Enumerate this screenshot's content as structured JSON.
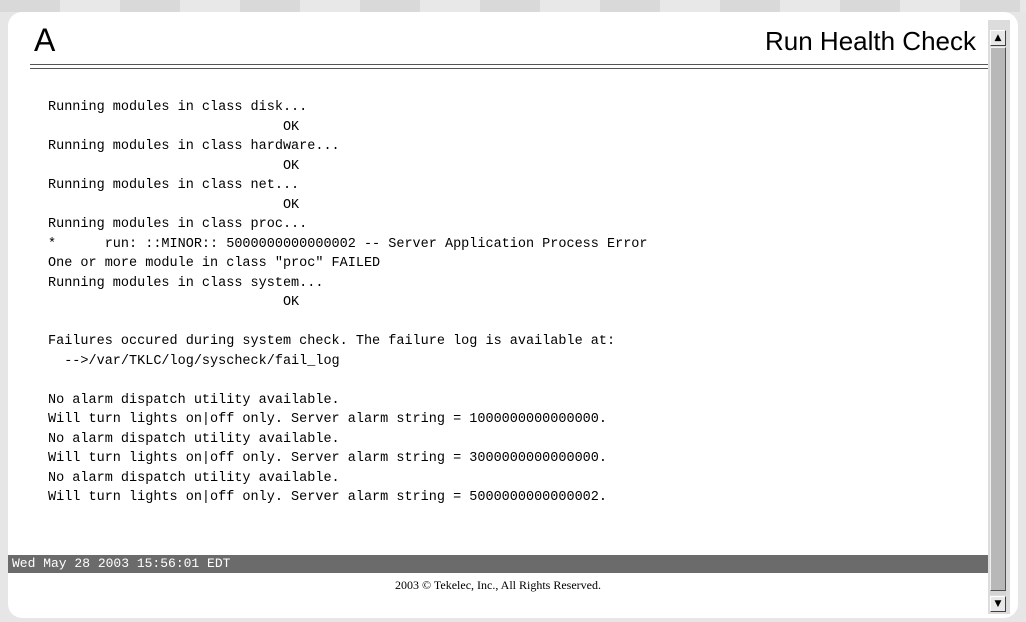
{
  "header": {
    "logo": "A",
    "title": "Run Health Check"
  },
  "output": {
    "lines": [
      "Running modules in class disk...",
      "                             OK",
      "Running modules in class hardware...",
      "                             OK",
      "Running modules in class net...",
      "                             OK",
      "Running modules in class proc...",
      "*      run: ::MINOR:: 5000000000000002 -- Server Application Process Error",
      "One or more module in class \"proc\" FAILED",
      "Running modules in class system...",
      "                             OK",
      "",
      "Failures occured during system check. The failure log is available at:",
      "  -->/var/TKLC/log/syscheck/fail_log",
      "",
      "No alarm dispatch utility available.",
      "Will turn lights on|off only. Server alarm string = 1000000000000000.",
      "No alarm dispatch utility available.",
      "Will turn lights on|off only. Server alarm string = 3000000000000000.",
      "No alarm dispatch utility available.",
      "Will turn lights on|off only. Server alarm string = 5000000000000002."
    ]
  },
  "status": {
    "timestamp": "Wed May 28 2003 15:56:01 EDT"
  },
  "footer": {
    "copyright": "2003 © Tekelec, Inc., All Rights Reserved."
  },
  "scrollbar": {
    "up_icon": "▲",
    "down_icon": "▼",
    "position_fraction": 0
  }
}
